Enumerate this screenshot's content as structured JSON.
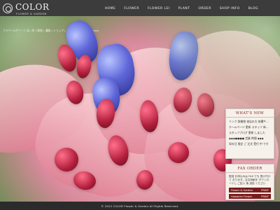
{
  "brand": {
    "title": "COLOR",
    "subtitle": "FLOWER & GARDEN"
  },
  "nav": [
    {
      "label": "HOME"
    },
    {
      "label": "FLOWER"
    },
    {
      "label": "FLOWER LEI"
    },
    {
      "label": "PLANT"
    },
    {
      "label": "ORDER"
    },
    {
      "label": "SHOP INFO"
    },
    {
      "label": "BLOG"
    }
  ],
  "hero": {
    "tagline": "フラワー&グリーン 店 | 町 | 駅前 | 通販 | ショップ | COLOR Flower & Garden"
  },
  "whats_new": {
    "title": "WHAT'S NEW",
    "items": [
      "リンク 鉢植物 来店の方 各種ギフト…",
      "ホームページ 更新 スタッフ 新しい商品を…",
      "スタッフブログ 更新 しました",
      "◆◆◆●●●● 営業 時間 ◆◆◆",
      "母の日 限定 ご 注文 受付 中 です"
    ]
  },
  "fax_order": {
    "title": "FAX ORDER",
    "text": "配送 お申込みは FAX でも 受け付けて おります。注文用紙を ダウンロードし ご記入 後 送信 ください",
    "rows": [
      {
        "label": "Flower & Garden",
        "badge": "PRINT"
      },
      {
        "label": "Hawaiian Flower",
        "badge": "PRINT"
      }
    ]
  },
  "footer": {
    "copyright": "© 2022 COLOR Flower & Garden All Rights Reserved."
  },
  "colors": {
    "header_bg": "#3c3c3c",
    "panel_accent": "#7a1b1b",
    "panel_bg": "#f6f1ea",
    "footer_bg": "#2b2b2b"
  },
  "icons": {
    "logo": "circle-logo-icon"
  }
}
